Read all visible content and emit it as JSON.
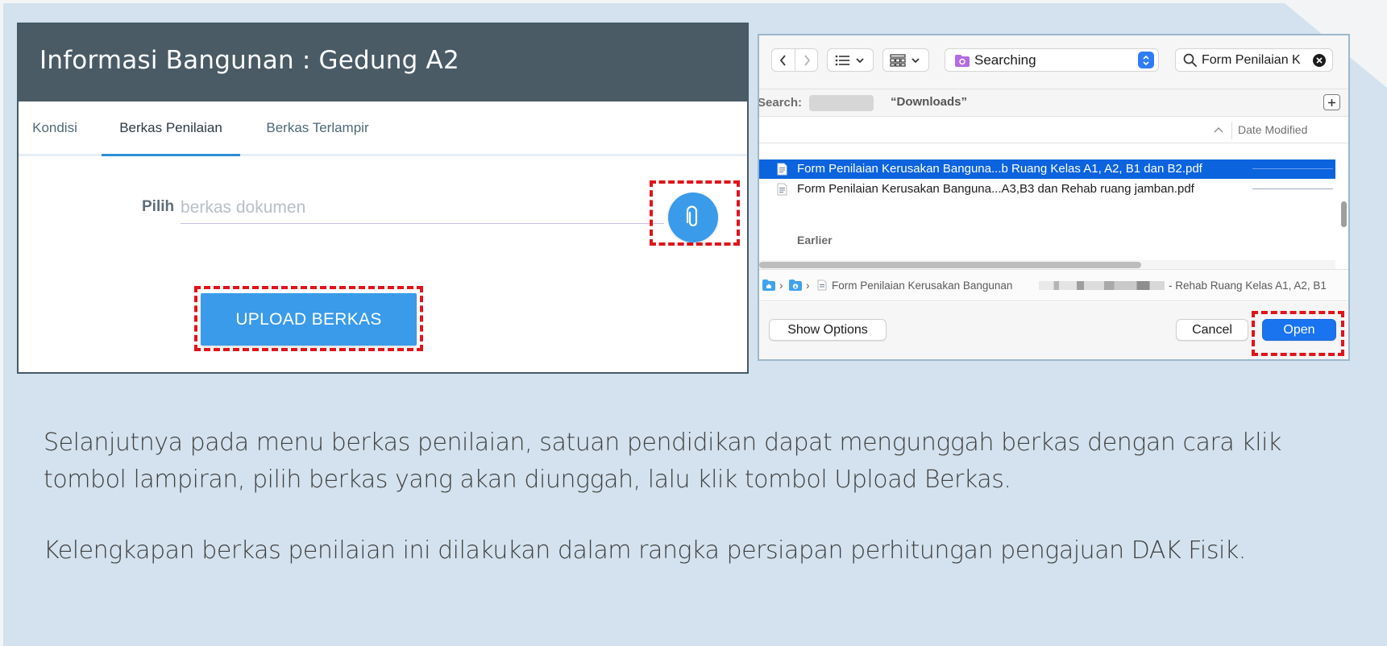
{
  "web_app": {
    "title": "Informasi Bangunan : Gedung A2",
    "tabs": [
      {
        "label": "Kondisi",
        "active": false
      },
      {
        "label": "Berkas Penilaian",
        "active": true
      },
      {
        "label": "Berkas Terlampir",
        "active": false
      }
    ],
    "pilih_label": "Pilih",
    "file_input_placeholder": "berkas dokumen",
    "attach_icon": "paperclip-icon",
    "upload_button": "UPLOAD BERKAS",
    "accent_color": "#3a9bea",
    "header_color": "#4a5b66",
    "highlight_color": "#e0141b"
  },
  "file_dialog": {
    "location": "Searching",
    "search_value": "Form Penilaian K",
    "scope_label": "Search:",
    "scope_selected": "“Downloads”",
    "column_header": "Date Modified",
    "files": [
      {
        "name": "Form Penilaian Kerusakan Banguna...b Ruang Kelas A1, A2, B1 dan B2.pdf",
        "selected": true
      },
      {
        "name": "Form Penilaian Kerusakan Banguna...A3,B3 dan Rehab ruang jamban.pdf",
        "selected": false
      }
    ],
    "group_label": "Earlier",
    "path_file": "Form Penilaian Kerusakan Bangunan",
    "path_suffix": "- Rehab Ruang Kelas A1, A2, B1",
    "show_options_button": "Show Options",
    "cancel_button": "Cancel",
    "open_button": "Open",
    "open_button_color": "#1a74ef"
  },
  "description": {
    "paragraph_1": "Selanjutnya pada menu berkas penilaian, satuan pendidikan dapat mengunggah berkas dengan cara klik tombol lampiran, pilih berkas yang akan diunggah, lalu klik tombol Upload Berkas.",
    "paragraph_2": "Kelengkapan berkas penilaian ini dilakukan dalam rangka persiapan perhitungan pengajuan DAK Fisik."
  }
}
